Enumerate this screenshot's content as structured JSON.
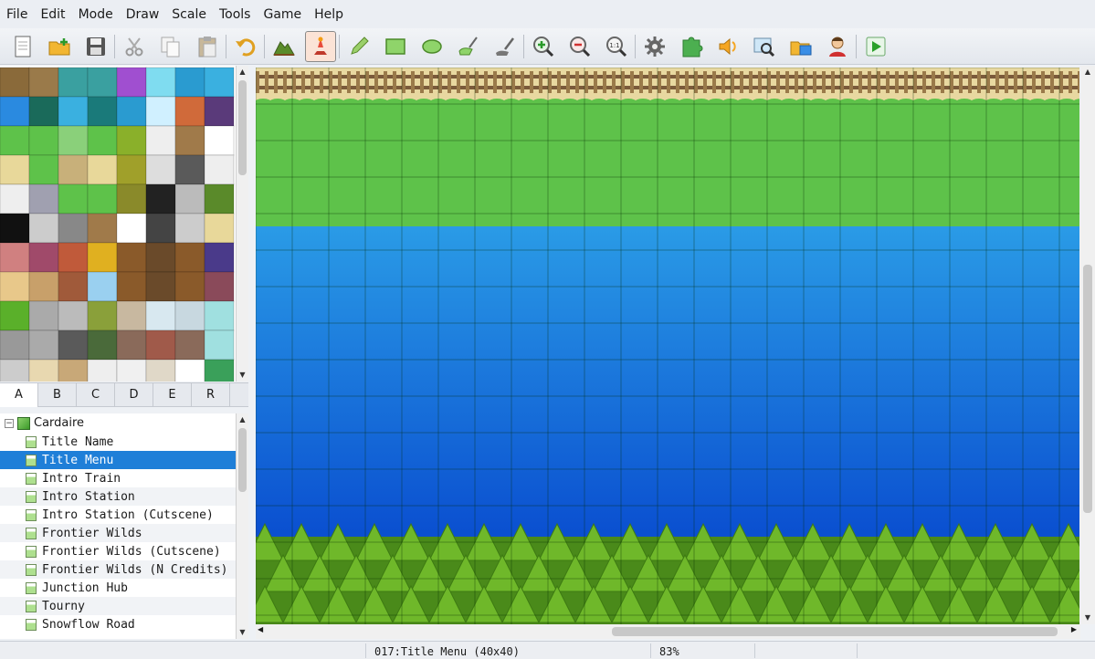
{
  "menu": [
    "File",
    "Edit",
    "Mode",
    "Draw",
    "Scale",
    "Tools",
    "Game",
    "Help"
  ],
  "toolbar": {
    "groups": [
      [
        "new-project-icon",
        "open-project-icon",
        "save-icon"
      ],
      [
        "cut-icon",
        "copy-icon",
        "paste-icon"
      ],
      [
        "undo-icon"
      ],
      [
        "map-layer-icon",
        "event-layer-icon"
      ],
      [
        "pencil-icon",
        "rectangle-icon",
        "ellipse-icon",
        "fill-icon",
        "select-icon"
      ],
      [
        "zoom-in-icon",
        "zoom-out-icon",
        "zoom-actual-icon"
      ],
      [
        "database-icon",
        "plugin-icon",
        "sound-test-icon",
        "event-search-icon",
        "resource-manager-icon",
        "character-generator-icon"
      ],
      [
        "playtest-icon"
      ]
    ],
    "active": "event-layer-icon",
    "zoom_actual_label": "1:1"
  },
  "tile_tabs": [
    "A",
    "B",
    "C",
    "D",
    "E",
    "R"
  ],
  "active_tab": "A",
  "tree": {
    "root": "Cardaire",
    "items": [
      "Title Name",
      "Title Menu",
      "Intro Train",
      "Intro Station",
      "Intro Station (Cutscene)",
      "Frontier Wilds",
      "Frontier Wilds (Cutscene)",
      "Frontier Wilds (N Credits)",
      "Junction Hub",
      "Tourny",
      "Snowflow Road"
    ],
    "selected_index": 1
  },
  "status": {
    "map_info": "017:Title Menu (40x40)",
    "zoom": "83%"
  },
  "colors": {
    "selection": "#1f7fd8",
    "grass": "#5ec24a",
    "water_top": "#2a9be6",
    "water_bottom": "#0a4fd0",
    "tree_canopy": "#6fb82a"
  }
}
